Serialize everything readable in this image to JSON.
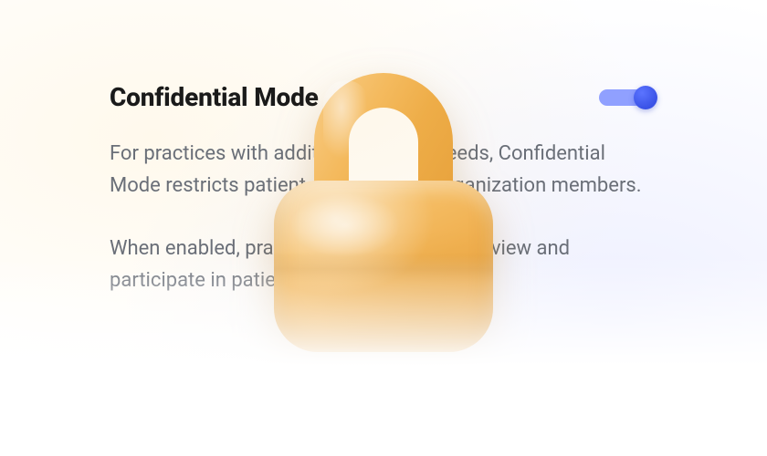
{
  "settings": {
    "title": "Confidential Mode",
    "toggle_on": true,
    "description_1": "For practices with additional privacy needs, Confidential Mode restricts patient access for all organization members.",
    "description_2": "When enabled, practice members can only view and participate in patient chats that are"
  },
  "colors": {
    "accent": "#3a52e6",
    "text": "#1a1a1a",
    "muted": "#6a6f78",
    "lock": "#f0b050"
  }
}
